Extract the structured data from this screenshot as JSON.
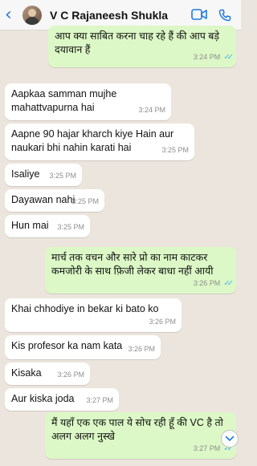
{
  "header": {
    "back_glyph": "‹",
    "contact_name": "V C Rajaneesh Shukla"
  },
  "messages": [
    {
      "dir": "out",
      "text": "आप क्या साबित करना चाह रहे हैं की आप बड़े दयावान हैं",
      "time": "3:24 PM",
      "read": true
    },
    {
      "dir": "in",
      "text": "Aapkaa samman mujhe mahattvapurna hai",
      "time": "3:24 PM"
    },
    {
      "dir": "in",
      "text": "Aapne 90 hajar kharch kiye Hain aur naukari bhi nahin karati hai",
      "time": "3:25 PM"
    },
    {
      "dir": "in",
      "text": "Isaliye",
      "time": "3:25 PM"
    },
    {
      "dir": "in",
      "text": "Dayawan nahi",
      "time": "3:25 PM"
    },
    {
      "dir": "in",
      "text": "Hun mai",
      "time": "3:25 PM"
    },
    {
      "dir": "out",
      "text": "मार्च तक वचन और सारे प्रो का नाम काटकर कमजोरी के साथ फ़िजी लेकर बाधा नहीं आयी",
      "time": "3:26 PM",
      "read": true
    },
    {
      "dir": "in",
      "text": "Khai chhodiye in bekar ki bato ko",
      "time": "3:26 PM"
    },
    {
      "dir": "in",
      "text": "Kis profesor ka nam kata",
      "time": "3:26 PM"
    },
    {
      "dir": "in",
      "text": "Kisaka",
      "time": "3:26 PM"
    },
    {
      "dir": "in",
      "text": "Aur kiska joda",
      "time": "3:27 PM"
    },
    {
      "dir": "out",
      "text": "मैं यहाँ एक एक पाल ये सोच रही हूँ की VC है तो अलग अलग नुस्खे",
      "time": "3:27 PM",
      "read": true
    }
  ],
  "colors": {
    "incoming": "#ffffff",
    "outgoing": "#dcf8c6",
    "background": "#ece5dd",
    "accent": "#1f7ae0",
    "read_ticks": "#4fb6ec"
  },
  "icons": [
    "back-chevron-icon",
    "avatar",
    "video-call-icon",
    "phone-call-icon",
    "read-ticks-icon",
    "scroll-down-icon"
  ]
}
